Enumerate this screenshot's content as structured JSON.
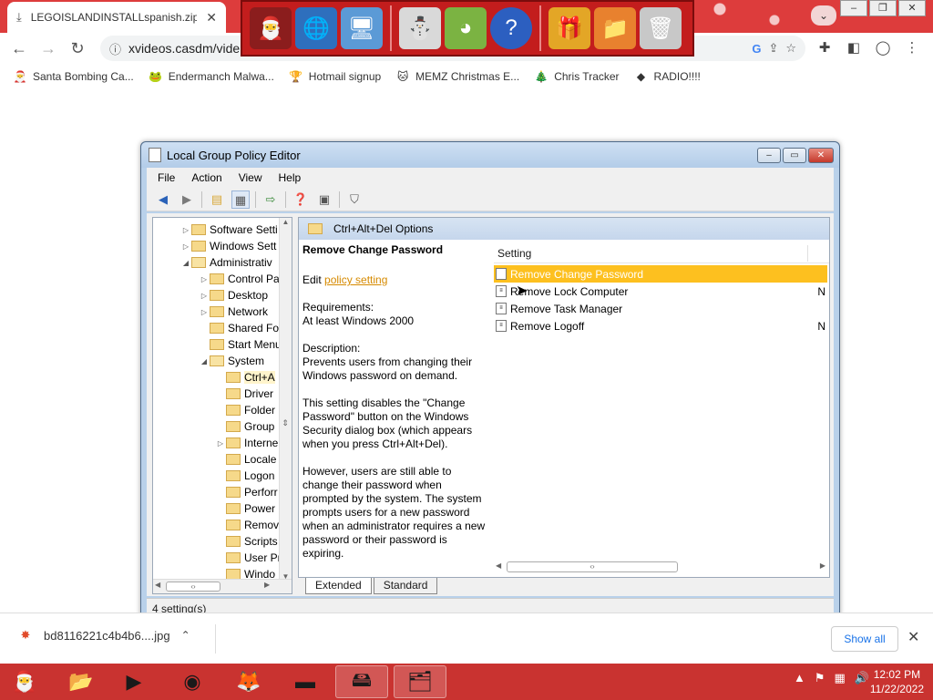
{
  "browser": {
    "tab_title": "LEGOISLANDINSTALLspanish.zip",
    "url": "xvideos.casdm/vide",
    "bookmarks": [
      {
        "label": "Santa Bombing Ca...",
        "icon": "santa-icon"
      },
      {
        "label": "Endermanch Malwa...",
        "icon": "frog-icon"
      },
      {
        "label": "Hotmail signup",
        "icon": "trophy-icon"
      },
      {
        "label": "MEMZ Christmas E...",
        "icon": "cat-icon"
      },
      {
        "label": "Chris Tracker",
        "icon": "ornament-icon"
      },
      {
        "label": "RADIO!!!!",
        "icon": "gem-icon"
      }
    ]
  },
  "gpedit": {
    "title": "Local Group Policy Editor",
    "menu": [
      "File",
      "Action",
      "View",
      "Help"
    ],
    "tree": [
      {
        "label": "Software Setti",
        "indent": 1,
        "exp": "▷"
      },
      {
        "label": "Windows Sett",
        "indent": 1,
        "exp": "▷"
      },
      {
        "label": "Administrativ",
        "indent": 1,
        "exp": "◢"
      },
      {
        "label": "Control Pa",
        "indent": 2,
        "exp": "▷"
      },
      {
        "label": "Desktop",
        "indent": 2,
        "exp": "▷"
      },
      {
        "label": "Network",
        "indent": 2,
        "exp": "▷"
      },
      {
        "label": "Shared Fol",
        "indent": 2,
        "exp": ""
      },
      {
        "label": "Start Menu",
        "indent": 2,
        "exp": ""
      },
      {
        "label": "System",
        "indent": 2,
        "exp": "◢"
      },
      {
        "label": "Ctrl+A",
        "indent": 3,
        "exp": "",
        "selected": true
      },
      {
        "label": "Driver",
        "indent": 3,
        "exp": ""
      },
      {
        "label": "Folder",
        "indent": 3,
        "exp": ""
      },
      {
        "label": "Group",
        "indent": 3,
        "exp": ""
      },
      {
        "label": "Interne",
        "indent": 3,
        "exp": "▷"
      },
      {
        "label": "Locale",
        "indent": 3,
        "exp": ""
      },
      {
        "label": "Logon",
        "indent": 3,
        "exp": ""
      },
      {
        "label": "Perforr",
        "indent": 3,
        "exp": ""
      },
      {
        "label": "Power",
        "indent": 3,
        "exp": ""
      },
      {
        "label": "Remov",
        "indent": 3,
        "exp": ""
      },
      {
        "label": "Scripts",
        "indent": 3,
        "exp": ""
      },
      {
        "label": "User Pr",
        "indent": 3,
        "exp": ""
      },
      {
        "label": "Windo",
        "indent": 3,
        "exp": ""
      }
    ],
    "detail_header": "Ctrl+Alt+Del Options",
    "desc": {
      "heading": "Remove Change Password",
      "edit_prefix": "Edit",
      "edit_link": "policy setting",
      "requirements": "Requirements:\nAt least Windows 2000",
      "description": "Description:\nPrevents users from changing their Windows password on demand.",
      "p2": "This setting disables the \"Change Password\" button on the Windows Security dialog box (which appears when you press Ctrl+Alt+Del).",
      "p3": "However, users are still able to change their password when prompted by the system. The system prompts users for a new password when an administrator requires a new password or their password is expiring."
    },
    "settings_column": "Setting",
    "settings": [
      {
        "label": "Remove Change Password",
        "state": "",
        "selected": true
      },
      {
        "label": "Remove Lock Computer",
        "state": "N"
      },
      {
        "label": "Remove Task Manager",
        "state": ""
      },
      {
        "label": "Remove Logoff",
        "state": "N"
      }
    ],
    "tabs": [
      "Extended",
      "Standard"
    ],
    "status": "4 setting(s)"
  },
  "download": {
    "filename": "bd8116221c4b4b6....jpg",
    "show_all": "Show all"
  },
  "clock": {
    "time": "12:02 PM",
    "date": "11/22/2022"
  }
}
